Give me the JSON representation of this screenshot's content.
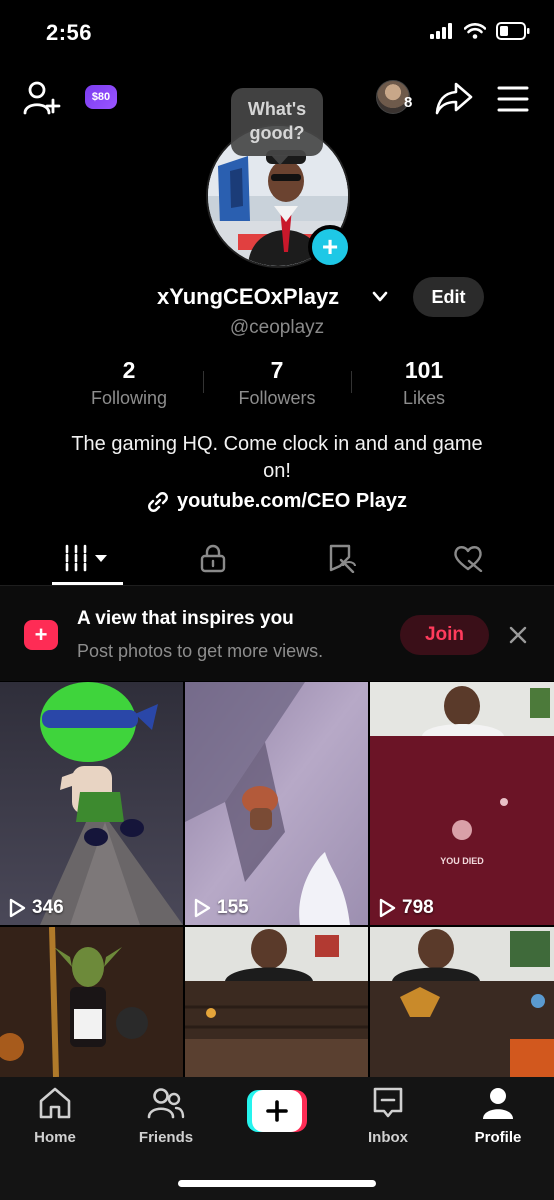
{
  "status_bar": {
    "time": "2:56",
    "icons": [
      "cellular-signal-icon",
      "wifi-icon",
      "battery-icon"
    ]
  },
  "top_bar": {
    "coin_badge": "$80",
    "story_count": "8",
    "icons": [
      "add-friend-icon",
      "share-icon",
      "menu-icon"
    ]
  },
  "profile": {
    "bubble_text": "What's good?",
    "add_icon": "+",
    "display_name": "xYungCEOxPlayz",
    "username": "@ceoplayz",
    "edit_label": "Edit",
    "bio": "The gaming HQ. Come clock in and and game on!",
    "link": "youtube.com/CEO Playz"
  },
  "stats": [
    {
      "value": "2",
      "label": "Following"
    },
    {
      "value": "7",
      "label": "Followers"
    },
    {
      "value": "101",
      "label": "Likes"
    }
  ],
  "tabs": [
    "videos-grid-icon",
    "private-lock-icon",
    "tagged-icon",
    "liked-icon"
  ],
  "banner": {
    "icon": "+",
    "title": "A view that inspires you",
    "subtitle": "Post photos to get more views.",
    "join_label": "Join"
  },
  "videos": [
    {
      "views": "346"
    },
    {
      "views": "155"
    },
    {
      "views": "798",
      "overlay_text": "YOU DIED"
    },
    {
      "views": ""
    },
    {
      "views": ""
    },
    {
      "views": ""
    }
  ],
  "bottom_nav": {
    "items": [
      {
        "label": "Home",
        "icon": "home-icon"
      },
      {
        "label": "Friends",
        "icon": "friends-icon"
      },
      {
        "label": "",
        "icon": "create-icon"
      },
      {
        "label": "Inbox",
        "icon": "inbox-icon"
      },
      {
        "label": "Profile",
        "icon": "profile-icon"
      }
    ],
    "active": "Profile",
    "create_symbol": "+"
  },
  "colors": {
    "background": "#000000",
    "accent_red": "#fe2c55",
    "accent_cyan": "#1ec8e6",
    "coin_purple": "#8b46f8"
  }
}
